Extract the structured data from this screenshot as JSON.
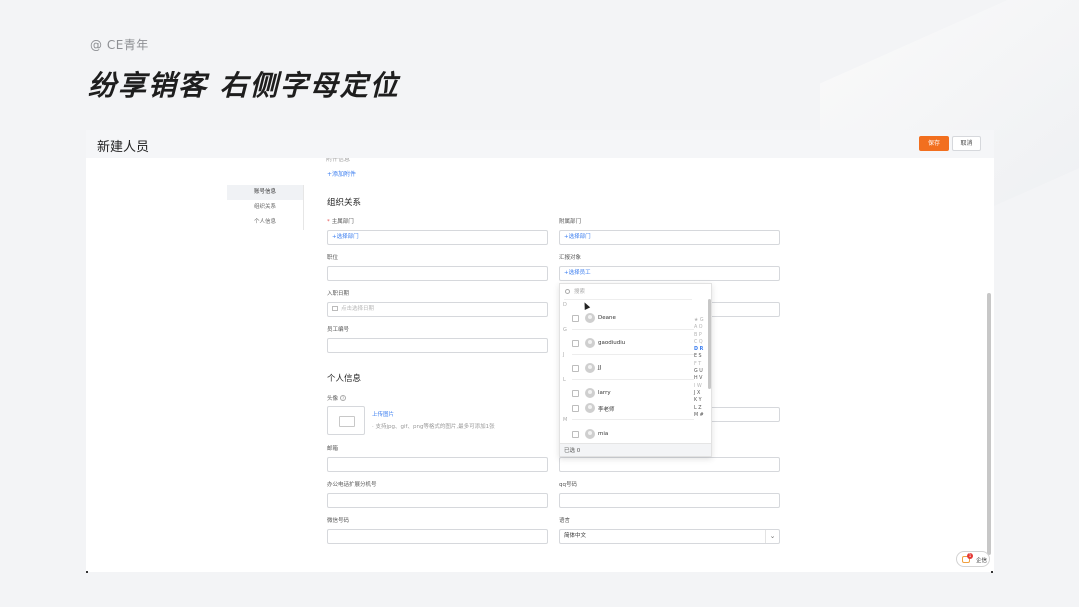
{
  "header": {
    "brand": "@ CE青年",
    "headline": "纷享销客 右侧字母定位"
  },
  "window": {
    "title": "新建人员",
    "save_label": "保存",
    "cancel_label": "取消"
  },
  "top": {
    "cut_text": "附件信息",
    "add_attachment": "+添加附件"
  },
  "nav": {
    "items": [
      "账号信息",
      "组织关系",
      "个人信息"
    ],
    "active_index": 0
  },
  "org": {
    "title": "组织关系",
    "main_dept_label": "主属部门",
    "main_dept_value": "+选择部门",
    "sub_dept_label": "附属部门",
    "sub_dept_value": "+选择部门",
    "position_label": "职位",
    "report_label": "汇报对象",
    "report_value": "+选择员工",
    "join_date_label": "入职日期",
    "join_date_placeholder": "点击选择日期",
    "emp_no_label": "员工编号"
  },
  "personal": {
    "title": "个人信息",
    "avatar_label": "头像",
    "upload": "上传图片",
    "upload_hint": "· 支持jpg、gif、png等格式的图片,最多可添加1张",
    "email_label": "邮箱",
    "ext_label": "办公电话扩展分机号",
    "qq_label": "qq号码",
    "wechat_label": "微信号码",
    "lang_label": "语言",
    "lang_value": "简体中文"
  },
  "dropdown": {
    "search_placeholder": "搜索",
    "groups": {
      "D": "D",
      "G": "G",
      "J": "J",
      "L": "L",
      "M": "M"
    },
    "users": {
      "deane": "Deane",
      "gaodiudiu": "gaodiudiu",
      "jj": "JJ",
      "larry": "larry",
      "lilaoshi": "李老师",
      "mia": "mia"
    },
    "alphabet": {
      "r0": "★ G",
      "r1": "A O",
      "r2": "B P",
      "r3": "C Q",
      "r4": "D R",
      "r5": "E S",
      "r6": "F T",
      "r7": "G U",
      "r8": "H V",
      "r9": "I W",
      "r10": "J X",
      "r11": "K Y",
      "r12": "L Z",
      "r13": "M #"
    },
    "active_letter": "D",
    "selected": "已选 0"
  },
  "chat": {
    "badge": "1",
    "label": "企信"
  },
  "colors": {
    "primary": "#f26f1f",
    "link": "#3a7df0",
    "required": "#e55353",
    "badge": "#e53935"
  }
}
